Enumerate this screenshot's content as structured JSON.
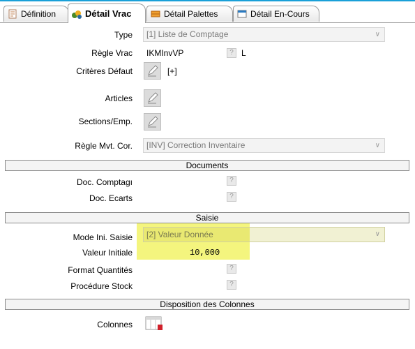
{
  "tabs": [
    {
      "label": "Définition",
      "icon": "definition-icon"
    },
    {
      "label": "Détail Vrac",
      "icon": "bulk-detail-icon"
    },
    {
      "label": "Détail Palettes",
      "icon": "pallet-detail-icon"
    },
    {
      "label": "Détail En-Cours",
      "icon": "in-progress-detail-icon"
    }
  ],
  "form": {
    "type_label": "Type",
    "type_value": "[1] Liste de Comptage",
    "regle_vrac_label": "Règle Vrac",
    "regle_vrac_value": "IKMInvVP",
    "regle_vrac_suffix": "L",
    "criteres_label": "Critères Défaut",
    "criteres_value": "[+]",
    "articles_label": "Articles",
    "sections_label": "Sections/Emp.",
    "regle_mvt_label": "Règle Mvt. Cor.",
    "regle_mvt_value": "[INV] Correction Inventaire",
    "question_mark": "?"
  },
  "documents": {
    "section_title": "Documents",
    "doc_comptage_label": "Doc. Comptagı",
    "doc_ecarts_label": "Doc. Ecarts"
  },
  "saisie": {
    "section_title": "Saisie",
    "mode_label": "Mode Ini. Saisie",
    "mode_value": "[2] Valeur Donnée",
    "valeur_label": "Valeur Initiale",
    "valeur_value": "10,000",
    "format_label": "Format Quantités",
    "procedure_label": "Procédure Stock"
  },
  "colonnes": {
    "section_title": "Disposition des Colonnes",
    "colonnes_label": "Colonnes"
  },
  "colors": {
    "accent": "#1aa0d8",
    "highlight": "#f4f57e"
  }
}
